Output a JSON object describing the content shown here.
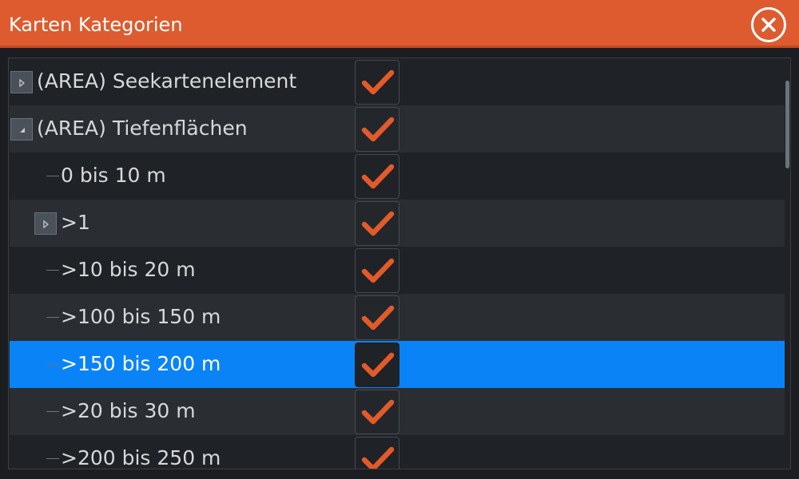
{
  "dialog": {
    "title": "Karten Kategorien",
    "close_icon": "close-icon"
  },
  "colors": {
    "title_bar": "#dd5b2e",
    "check_mark": "#e35a2a",
    "selected_row": "#0a83f7"
  },
  "rows": [
    {
      "label": "(AREA) Seekartenelement",
      "checked": true,
      "expander": "collapsed",
      "selected": false
    },
    {
      "label": "(AREA) Tiefenflächen",
      "checked": true,
      "expander": "expanded",
      "selected": false
    },
    {
      "label": "0 bis 10 m",
      "checked": true,
      "expander": "none",
      "selected": false
    },
    {
      "label": ">1",
      "checked": true,
      "expander": "collapsed",
      "selected": false
    },
    {
      "label": ">10 bis 20 m",
      "checked": true,
      "expander": "none",
      "selected": false
    },
    {
      "label": ">100 bis 150 m",
      "checked": true,
      "expander": "none",
      "selected": false
    },
    {
      "label": ">150 bis 200 m",
      "checked": true,
      "expander": "none",
      "selected": true
    },
    {
      "label": ">20 bis 30 m",
      "checked": true,
      "expander": "none",
      "selected": false
    },
    {
      "label": ">200 bis 250 m",
      "checked": true,
      "expander": "none",
      "selected": false
    }
  ]
}
